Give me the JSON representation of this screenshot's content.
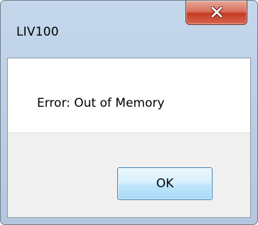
{
  "window": {
    "title": "LIV100",
    "close_icon": "close-x-icon"
  },
  "dialog": {
    "message": "Error: Out of Memory",
    "ok_label": "OK"
  },
  "colors": {
    "close_button": "#c43c25",
    "ok_button_border": "#3c7fb1",
    "footer_background": "#f0f0f0"
  }
}
